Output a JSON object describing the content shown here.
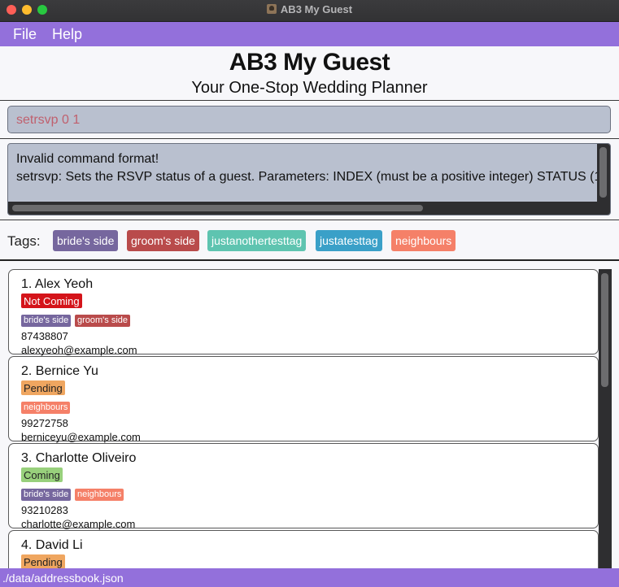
{
  "window": {
    "title": "AB3 My Guest"
  },
  "menu": {
    "file": "File",
    "help": "Help"
  },
  "header": {
    "title": "AB3 My Guest",
    "subtitle": "Your One-Stop Wedding Planner"
  },
  "command": {
    "value": "setrsvp 0 1"
  },
  "result": {
    "line1": "Invalid command format!",
    "line2": "setrsvp: Sets the RSVP status of a guest. Parameters: INDEX (must be a positive integer) STATUS (1"
  },
  "tags": {
    "label": "Tags:",
    "items": [
      {
        "name": "bride's side",
        "color": "#76679e"
      },
      {
        "name": "groom's side",
        "color": "#b94b4b"
      },
      {
        "name": "justanothertesttag",
        "color": "#5ec4b0"
      },
      {
        "name": "justatesttag",
        "color": "#3aa0c8"
      },
      {
        "name": "neighbours",
        "color": "#f58068"
      }
    ]
  },
  "persons": [
    {
      "name": "1. Alex Yeoh",
      "rsvp": "Not Coming",
      "tags": [
        "bride's side",
        "groom's side"
      ],
      "phone": "87438807",
      "email": "alexyeoh@example.com"
    },
    {
      "name": "2. Bernice Yu",
      "rsvp": "Pending",
      "tags": [
        "neighbours"
      ],
      "phone": "99272758",
      "email": "berniceyu@example.com"
    },
    {
      "name": "3. Charlotte Oliveiro",
      "rsvp": "Coming",
      "tags": [
        "bride's side",
        "neighbours"
      ],
      "phone": "93210283",
      "email": "charlotte@example.com"
    },
    {
      "name": "4. David Li",
      "rsvp": "Pending",
      "tags": [],
      "phone": "",
      "email": ""
    }
  ],
  "status": {
    "path": "./data/addressbook.json"
  }
}
